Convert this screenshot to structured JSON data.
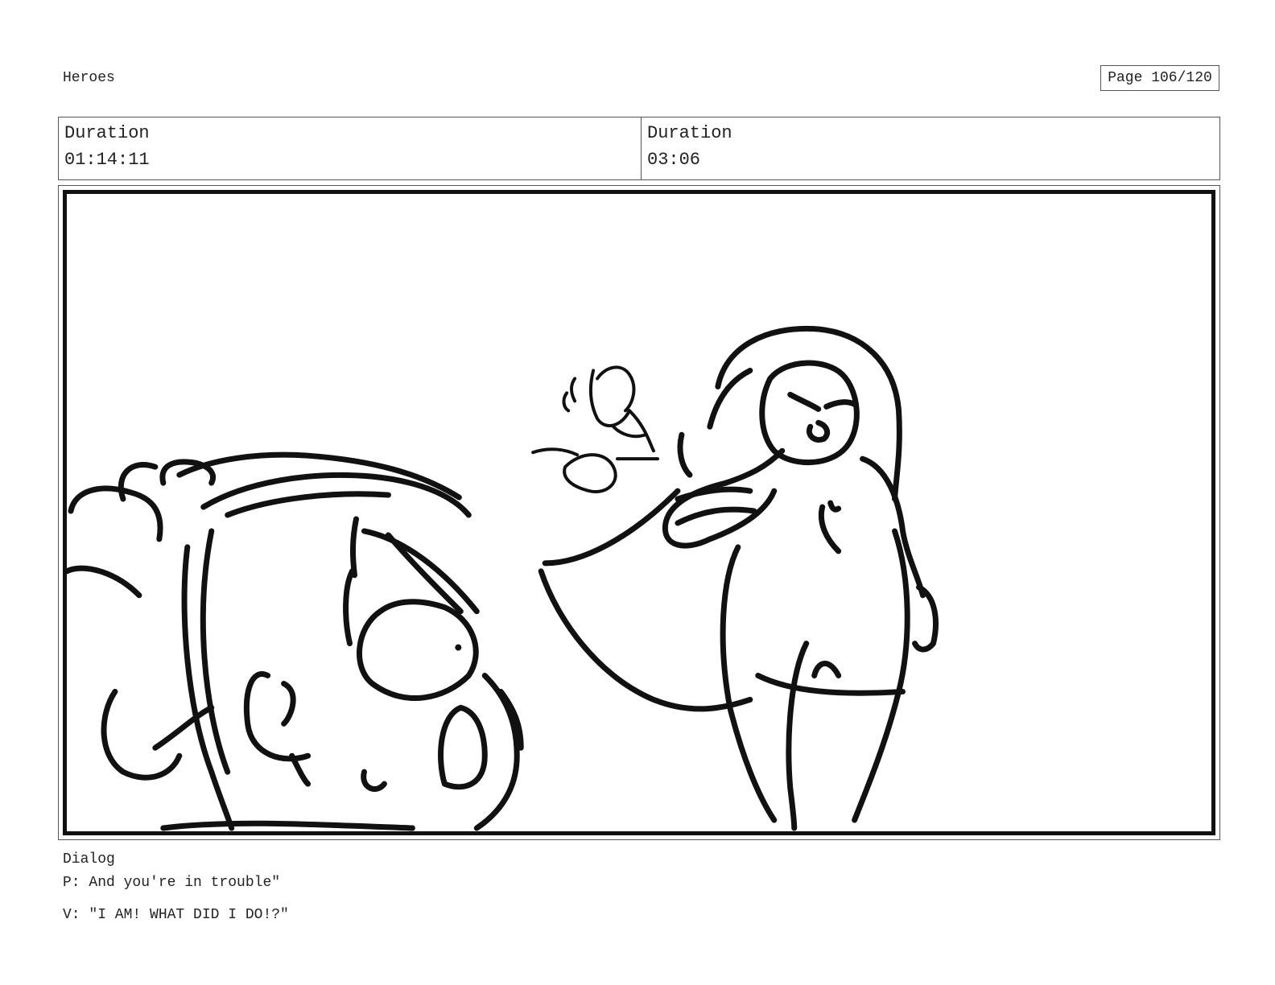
{
  "header": {
    "project_title": "Heroes",
    "page_label": "Page 106/120"
  },
  "durations": [
    {
      "label": "Duration",
      "value": "01:14:11"
    },
    {
      "label": "Duration",
      "value": "03:06"
    }
  ],
  "panel": {
    "image_semantic": "storyboard-sketch"
  },
  "dialog": {
    "heading": "Dialog",
    "lines": [
      "P: And you're in trouble\"",
      "V: \"I AM! WHAT DID I DO!?\""
    ]
  }
}
